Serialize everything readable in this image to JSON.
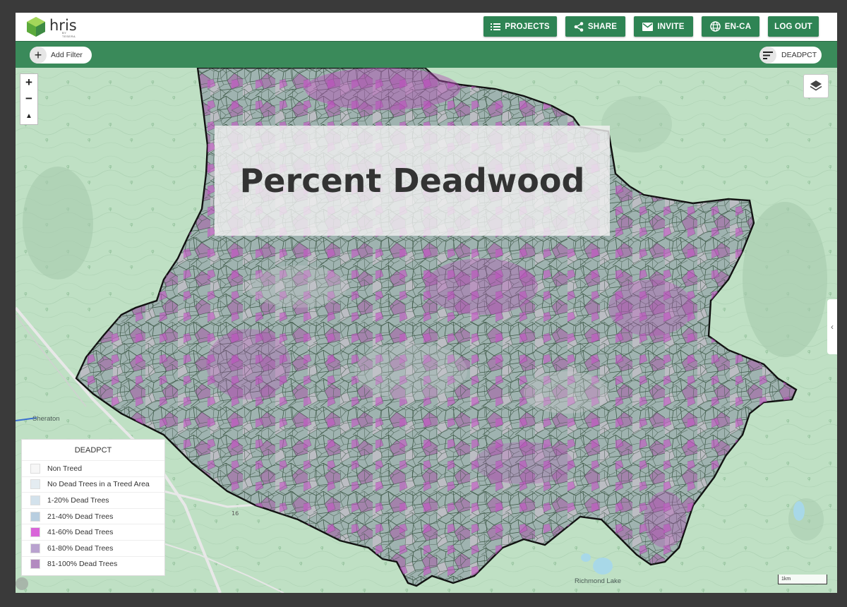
{
  "app": {
    "logo_text": "hris",
    "logo_sub": "BY TESERA"
  },
  "header": {
    "buttons": [
      {
        "label": "PROJECTS",
        "icon": "list-icon"
      },
      {
        "label": "SHARE",
        "icon": "share-icon"
      },
      {
        "label": "INVITE",
        "icon": "mail-icon"
      },
      {
        "label": "EN-CA",
        "icon": "globe-icon"
      },
      {
        "label": "LOG OUT",
        "icon": ""
      }
    ]
  },
  "toolbar": {
    "add_filter_label": "Add Filter",
    "field_label": "DEADPCT"
  },
  "map": {
    "title": "Percent Deadwood",
    "places": [
      "Sheraton",
      "Richmond Lake"
    ],
    "road_label": "16",
    "scale_label": "1km",
    "colors": {
      "base": "#bfe0c4",
      "boundary": "#111111",
      "accent": "#2e8454"
    }
  },
  "legend": {
    "title": "DEADPCT",
    "items": [
      {
        "label": "Non Treed",
        "color": "#f7f7f7"
      },
      {
        "label": "No Dead Trees in a Treed Area",
        "color": "#e4ecf1"
      },
      {
        "label": "1-20% Dead Trees",
        "color": "#d3e2ec"
      },
      {
        "label": "21-40% Dead Trees",
        "color": "#b8cee0"
      },
      {
        "label": "41-60% Dead Trees",
        "color": "#d965d9"
      },
      {
        "label": "61-80% Dead Trees",
        "color": "#b9a2cf"
      },
      {
        "label": "81-100% Dead Trees",
        "color": "#b38ac0"
      }
    ]
  }
}
